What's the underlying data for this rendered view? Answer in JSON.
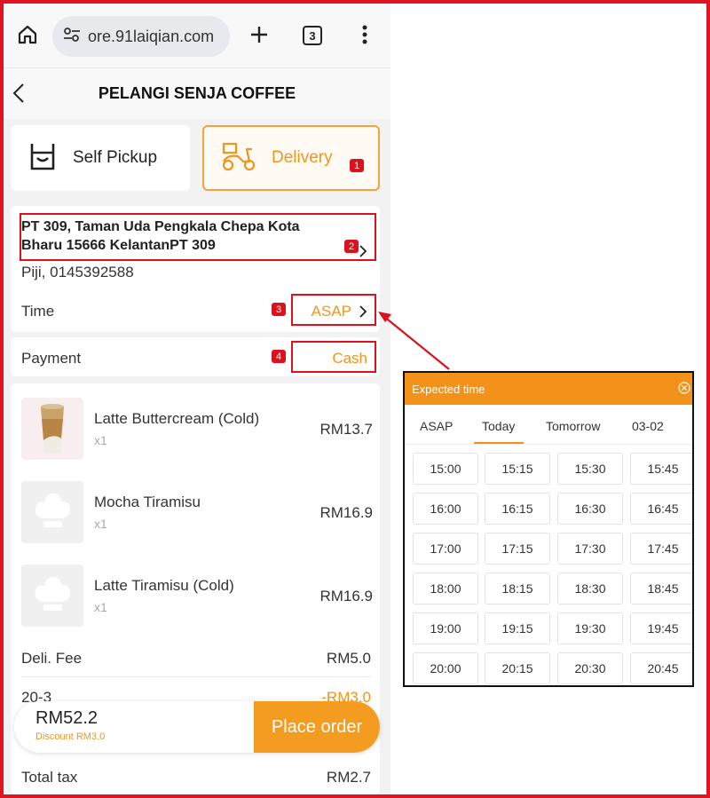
{
  "browser": {
    "url": "ore.91laiqian.com",
    "tab_count": "3"
  },
  "header": {
    "title": "PELANGI SENJA COFFEE"
  },
  "modes": {
    "self_pickup": "Self Pickup",
    "delivery": "Delivery"
  },
  "badges": [
    "1",
    "2",
    "3",
    "4"
  ],
  "address": {
    "line": "PT 309, Taman Uda Pengkala Chepa Kota Bharu 15666 KelantanPT 309",
    "contact": "Piji, 0145392588"
  },
  "time": {
    "label": "Time",
    "value": "ASAP"
  },
  "payment": {
    "label": "Payment",
    "value": "Cash"
  },
  "items": [
    {
      "name": "Latte Buttercream (Cold)",
      "qty": "x1",
      "price": "RM13.7"
    },
    {
      "name": "Mocha Tiramisu",
      "qty": "x1",
      "price": "RM16.9"
    },
    {
      "name": "Latte Tiramisu (Cold)",
      "qty": "x1",
      "price": "RM16.9"
    }
  ],
  "fees": {
    "delivery_label": "Deli. Fee",
    "delivery_value": "RM5.0",
    "promo_label": "20-3",
    "promo_value": "-RM3.0",
    "tax_label": "Total tax",
    "tax_value": "RM2.7"
  },
  "checkout": {
    "total": "RM52.2",
    "discount": "Discount RM3.0",
    "place_order": "Place order"
  },
  "popup": {
    "title": "Expected time",
    "tabs": [
      "ASAP",
      "Today",
      "Tomorrow",
      "03-02"
    ],
    "active_tab": "Today",
    "slots": [
      [
        "15:00",
        "15:15",
        "15:30",
        "15:45"
      ],
      [
        "16:00",
        "16:15",
        "16:30",
        "16:45"
      ],
      [
        "17:00",
        "17:15",
        "17:30",
        "17:45"
      ],
      [
        "18:00",
        "18:15",
        "18:30",
        "18:45"
      ],
      [
        "19:00",
        "19:15",
        "19:30",
        "19:45"
      ],
      [
        "20:00",
        "20:15",
        "20:30",
        "20:45"
      ]
    ]
  },
  "colors": {
    "accent": "#f39219",
    "highlight": "#d9121d"
  }
}
